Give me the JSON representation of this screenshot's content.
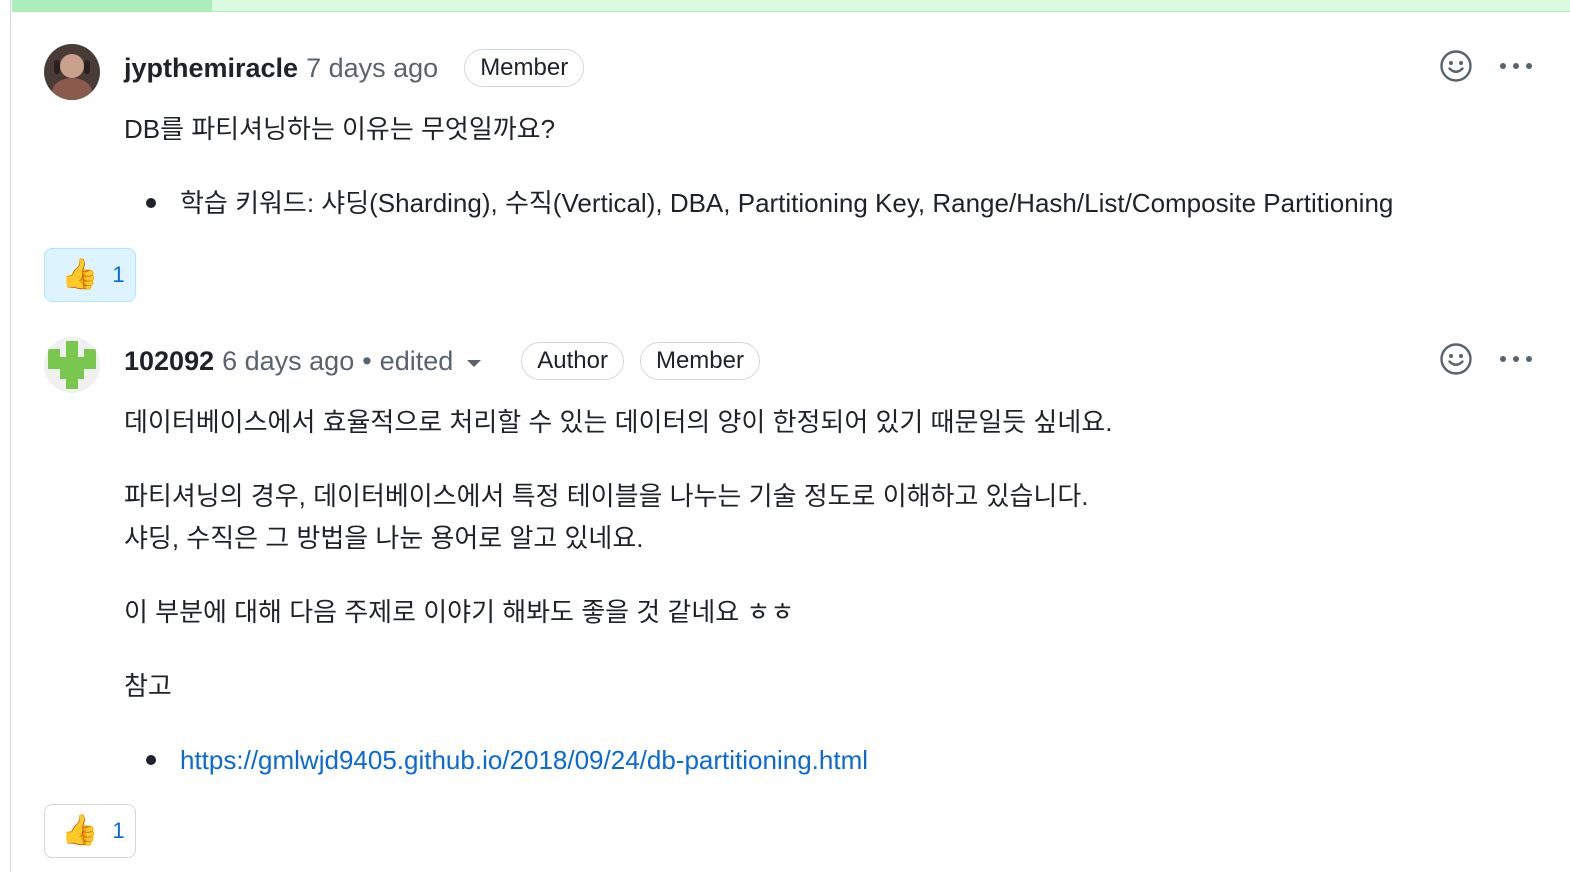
{
  "comments": [
    {
      "username": "jypthemiracle",
      "time": "7 days ago",
      "badges": [
        "Member"
      ],
      "body": {
        "question": "DB를 파티셔닝하는 이유는 무엇일까요?",
        "bullet": "학습 키워드: 샤딩(Sharding), 수직(Vertical), DBA, Partitioning Key, Range/Hash/List/Composite Partitioning"
      },
      "reaction": {
        "emoji": "👍",
        "count": "1"
      },
      "icons": {
        "avatar": "user-avatar-photo",
        "add_reaction": "smiley-icon",
        "more": "kebab-horizontal-icon"
      }
    },
    {
      "username": "102092",
      "time": "6 days ago",
      "separator": "•",
      "edited": "edited",
      "badges": [
        "Author",
        "Member"
      ],
      "body": {
        "p1": "데이터베이스에서 효율적으로 처리할 수 있는 데이터의 양이 한정되어 있기 때문일듯 싶네요.",
        "p2_line1": "파티셔닝의 경우, 데이터베이스에서 특정 테이블을 나누는 기술 정도로 이해하고 있습니다.",
        "p2_line2": "샤딩, 수직은 그 방법을 나눈 용어로 알고 있네요.",
        "p3": "이 부분에 대해 다음 주제로 이야기 해봐도 좋을 것 같네요 ㅎㅎ",
        "p4": "참고",
        "link": "https://gmlwjd9405.github.io/2018/09/24/db-partitioning.html"
      },
      "reaction": {
        "emoji": "👍",
        "count": "1"
      },
      "icons": {
        "avatar": "identicon-avatar",
        "add_reaction": "smiley-icon",
        "more": "kebab-horizontal-icon",
        "edited_dropdown": "triangle-down-icon"
      }
    }
  ],
  "colors": {
    "text": "#1f2328",
    "muted": "#59636e",
    "link": "#0969da",
    "border": "#d0d7de",
    "reaction_active_bg": "#ddf4ff",
    "identicon": "#7ac74f",
    "top_strip": "#dafbe1"
  }
}
